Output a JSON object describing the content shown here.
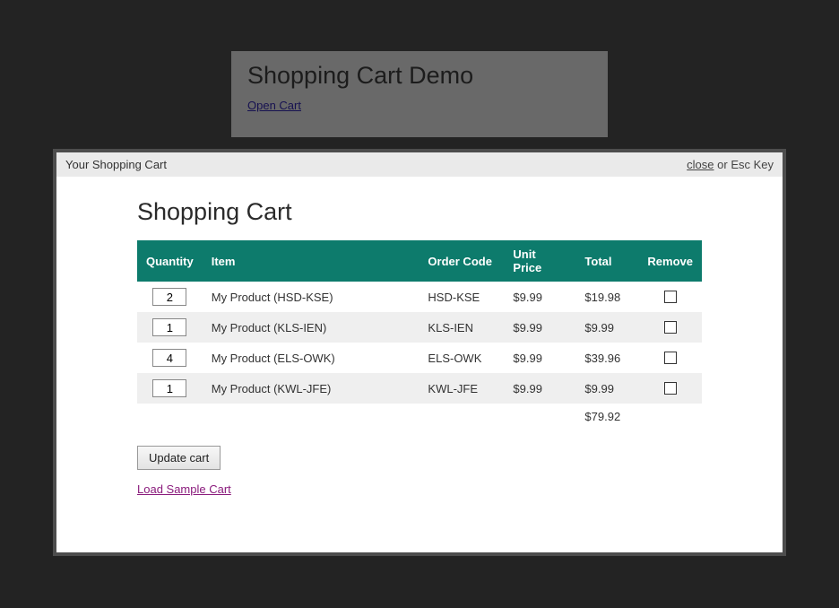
{
  "backdrop": {
    "title": "Shopping Cart Demo",
    "open_link": "Open Cart"
  },
  "modal": {
    "header_title": "Your Shopping Cart",
    "close_label": "close",
    "esc_label": " or Esc Key",
    "heading": "Shopping Cart"
  },
  "columns": {
    "qty": "Quantity",
    "item": "Item",
    "code": "Order Code",
    "price": "Unit Price",
    "total": "Total",
    "remove": "Remove"
  },
  "rows": [
    {
      "qty": "2",
      "item": "My Product (HSD-KSE)",
      "code": "HSD-KSE",
      "price": "$9.99",
      "total": "$19.98"
    },
    {
      "qty": "1",
      "item": "My Product (KLS-IEN)",
      "code": "KLS-IEN",
      "price": "$9.99",
      "total": "$9.99"
    },
    {
      "qty": "4",
      "item": "My Product (ELS-OWK)",
      "code": "ELS-OWK",
      "price": "$9.99",
      "total": "$39.96"
    },
    {
      "qty": "1",
      "item": "My Product (KWL-JFE)",
      "code": "KWL-JFE",
      "price": "$9.99",
      "total": "$9.99"
    }
  ],
  "grand_total": "$79.92",
  "update_button": "Update cart",
  "load_link": "Load Sample Cart"
}
